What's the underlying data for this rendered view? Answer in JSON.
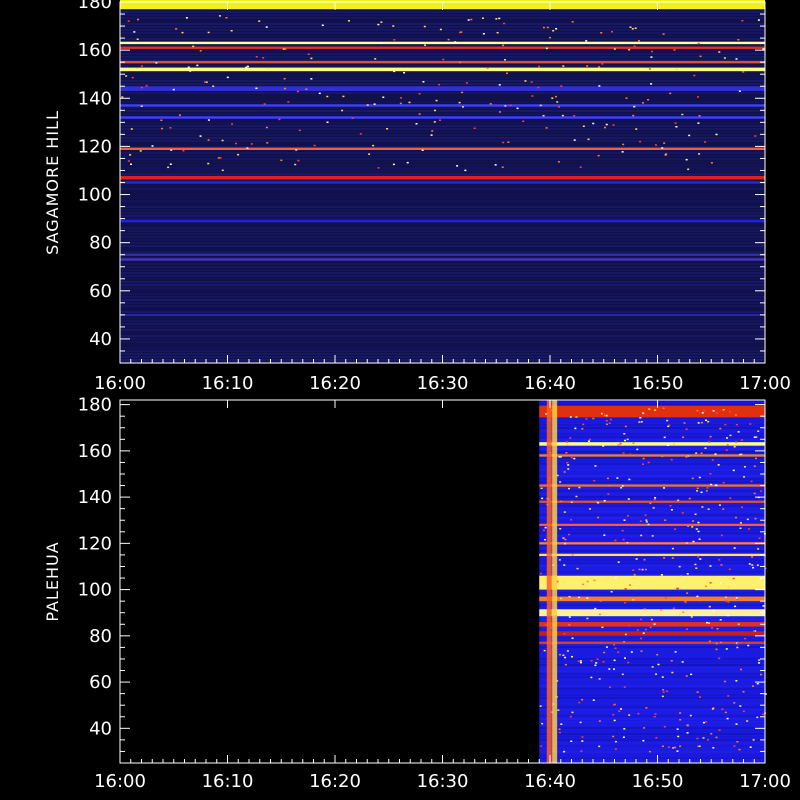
{
  "chart_data": [
    {
      "type": "heatmap",
      "ylabel": "SAGAMORE HILL",
      "xlim": [
        "16:00",
        "17:00"
      ],
      "ylim": [
        30,
        180
      ],
      "x_ticks": [
        "16:00",
        "16:10",
        "16:20",
        "16:30",
        "16:40",
        "16:50",
        "17:00"
      ],
      "y_ticks": [
        40,
        60,
        80,
        100,
        120,
        140,
        160,
        180
      ],
      "data_start": "16:00",
      "bands": [
        {
          "y": 179,
          "h": 4,
          "color": "#f0f020"
        },
        {
          "y": 163,
          "h": 1,
          "color": "#ffffa0"
        },
        {
          "y": 161,
          "h": 1,
          "color": "#e03030"
        },
        {
          "y": 155,
          "h": 1,
          "color": "#e05030"
        },
        {
          "y": 152,
          "h": 1.5,
          "color": "#ffff80"
        },
        {
          "y": 144,
          "h": 2,
          "color": "#3030d0"
        },
        {
          "y": 137,
          "h": 1,
          "color": "#4040ff"
        },
        {
          "y": 132,
          "h": 1,
          "color": "#4040ff"
        },
        {
          "y": 119,
          "h": 1,
          "color": "#f06040"
        },
        {
          "y": 107,
          "h": 1.5,
          "color": "#e02020"
        },
        {
          "y": 105,
          "h": 1,
          "color": "#2828d0"
        },
        {
          "y": 89,
          "h": 1,
          "color": "#2020e0"
        },
        {
          "y": 75,
          "h": 1,
          "color": "#3030a0"
        },
        {
          "y": 73,
          "h": 1,
          "color": "#5030c0"
        },
        {
          "y": 50,
          "h": 0.5,
          "color": "#3030c0"
        }
      ]
    },
    {
      "type": "heatmap",
      "ylabel": "PALEHUA",
      "xlim": [
        "16:00",
        "17:00"
      ],
      "ylim": [
        25,
        182
      ],
      "x_ticks": [
        "16:00",
        "16:10",
        "16:20",
        "16:30",
        "16:40",
        "16:50",
        "17:00"
      ],
      "y_ticks": [
        40,
        60,
        80,
        100,
        120,
        140,
        160,
        180
      ],
      "data_start": "16:39",
      "bands": [
        {
          "y": 177,
          "h": 5,
          "color": "#e03010"
        },
        {
          "y": 163,
          "h": 1.5,
          "color": "#ffff80"
        },
        {
          "y": 158,
          "h": 1,
          "color": "#f08020"
        },
        {
          "y": 145,
          "h": 1,
          "color": "#f07030"
        },
        {
          "y": 138,
          "h": 1,
          "color": "#e05030"
        },
        {
          "y": 128,
          "h": 1,
          "color": "#f06040"
        },
        {
          "y": 120,
          "h": 1,
          "color": "#ff8040"
        },
        {
          "y": 115,
          "h": 1,
          "color": "#ffe060"
        },
        {
          "y": 103,
          "h": 6,
          "color": "#fff070"
        },
        {
          "y": 96,
          "h": 2,
          "color": "#f08030"
        },
        {
          "y": 90,
          "h": 3,
          "color": "#fff0a0"
        },
        {
          "y": 85,
          "h": 2,
          "color": "#e03020"
        },
        {
          "y": 81,
          "h": 2,
          "color": "#c02020"
        },
        {
          "y": 77,
          "h": 1,
          "color": "#e04020"
        }
      ],
      "vlines": [
        {
          "x": "16:39.7",
          "color": "#ff6020"
        },
        {
          "x": "16:40.2",
          "color": "#ffd040"
        }
      ]
    }
  ]
}
